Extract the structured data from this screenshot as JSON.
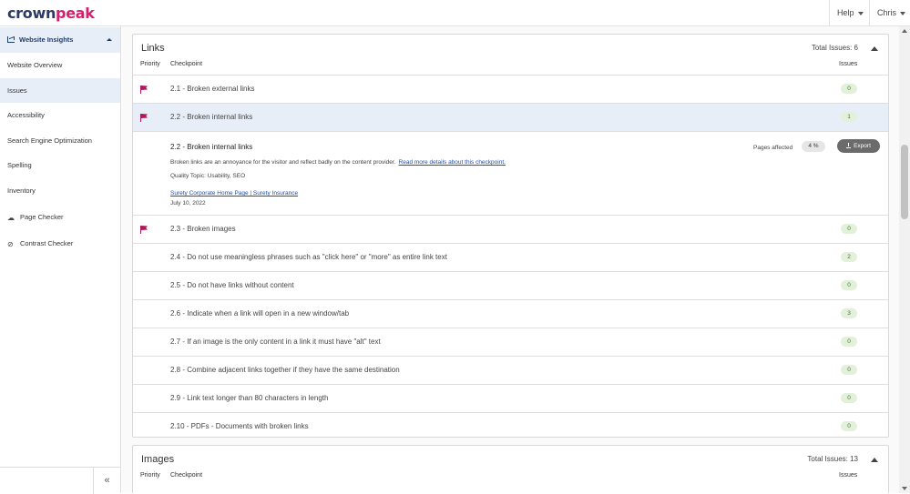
{
  "brand": {
    "part1": "crown",
    "part2": "peak"
  },
  "header": {
    "help_label": "Help",
    "user_label": "Chris"
  },
  "sidebar": {
    "section_label": "Website Insights",
    "items": [
      {
        "label": "Website Overview"
      },
      {
        "label": "Issues"
      },
      {
        "label": "Accessibility"
      },
      {
        "label": "Search Engine Optimization"
      },
      {
        "label": "Spelling"
      },
      {
        "label": "Inventory"
      }
    ],
    "tools": [
      {
        "label": "Page Checker",
        "icon": "cloud-check-icon"
      },
      {
        "label": "Contrast Checker",
        "icon": "eye-slash-icon"
      }
    ],
    "collapse_glyph": "«"
  },
  "links_panel": {
    "title": "Links",
    "total": "Total Issues: 6",
    "col_priority": "Priority",
    "col_checkpoint": "Checkpoint",
    "col_issues": "Issues",
    "rows": [
      {
        "label": "2.1 - Broken external links",
        "issues": "0",
        "flag": true
      },
      {
        "label": "2.2 - Broken internal links",
        "issues": "1",
        "flag": true
      },
      {
        "label": "2.3 - Broken images",
        "issues": "0",
        "flag": true
      },
      {
        "label": "2.4 - Do not use meaningless phrases such as \"click here\" or \"more\" as entire link text",
        "issues": "2",
        "flag": false
      },
      {
        "label": "2.5 - Do not have links without content",
        "issues": "0",
        "flag": false
      },
      {
        "label": "2.6 - Indicate when a link will open in a new window/tab",
        "issues": "3",
        "flag": false
      },
      {
        "label": "2.7 - If an image is the only content in a link it must have \"alt\" text",
        "issues": "0",
        "flag": false
      },
      {
        "label": "2.8 - Combine adjacent links together if they have the same destination",
        "issues": "0",
        "flag": false
      },
      {
        "label": "2.9 - Link text longer than 80 characters in length",
        "issues": "0",
        "flag": false
      },
      {
        "label": "2.10 - PDFs - Documents with broken links",
        "issues": "0",
        "flag": false
      }
    ],
    "detail": {
      "title": "2.2 - Broken internal links",
      "description": "Broken links are an annoyance for the visitor and reflect badly on the content provider.",
      "read_more": "Read more details about this checkpoint.",
      "quality": "Quality Topic: Usability, SEO",
      "page_link": "Surety Corporate Home Page | Surety Insurance",
      "date": "July 10, 2022",
      "pages_affected_label": "Pages affected",
      "pages_affected_value": "4 %",
      "export_label": "Export"
    }
  },
  "images_panel": {
    "title": "Images",
    "total": "Total Issues: 13",
    "col_priority": "Priority",
    "col_checkpoint": "Checkpoint",
    "col_issues": "Issues"
  },
  "colors": {
    "brand_navy": "#2b3a67",
    "brand_pink": "#d6206e",
    "flag": "#b0185e",
    "badge_bg": "#e3f0da",
    "highlight_bg": "#e7eef7"
  }
}
